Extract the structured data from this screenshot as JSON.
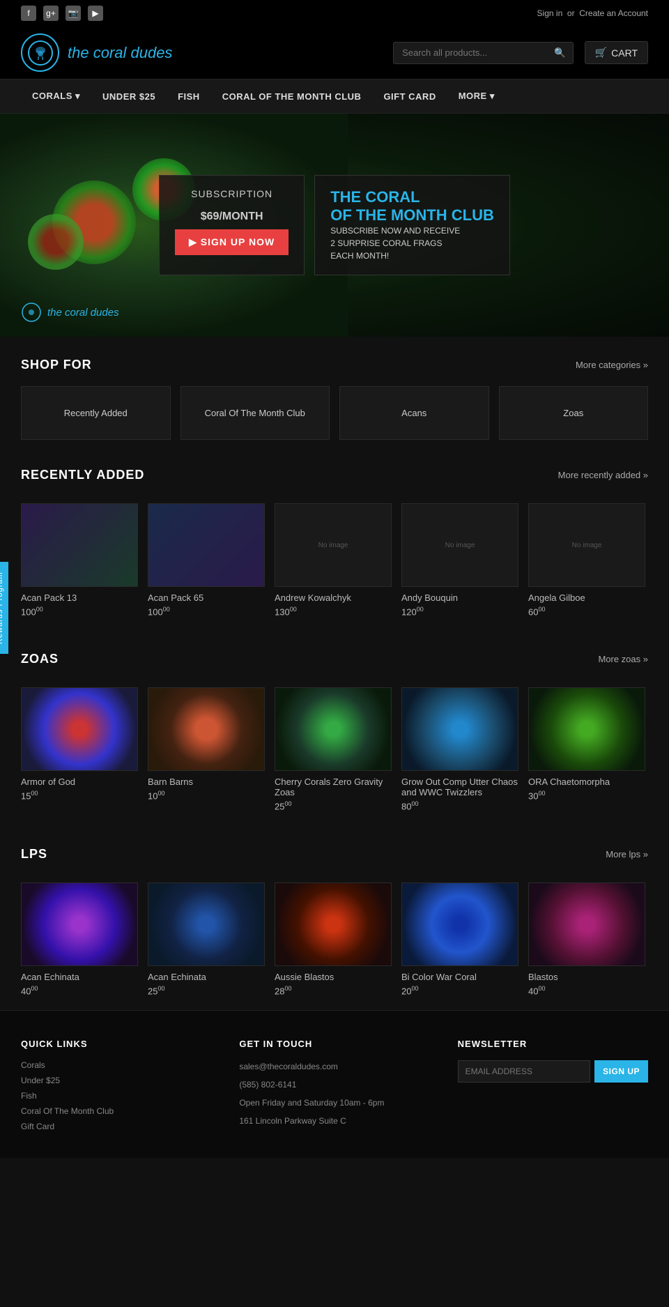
{
  "site": {
    "name": "the coral dudes",
    "tagline": "the coral dudes"
  },
  "top_bar": {
    "social_icons": [
      "f",
      "g+",
      "📷",
      "▶"
    ],
    "sign_in": "Sign in",
    "or": "or",
    "create_account": "Create an Account"
  },
  "header": {
    "search_placeholder": "Search all products...",
    "cart_label": "CART"
  },
  "nav": {
    "items": [
      {
        "label": "CORALS",
        "has_dropdown": true
      },
      {
        "label": "UNDER $25",
        "has_dropdown": false
      },
      {
        "label": "FISH",
        "has_dropdown": false
      },
      {
        "label": "CORAL OF THE MONTH CLUB",
        "has_dropdown": false
      },
      {
        "label": "GIFT CARD",
        "has_dropdown": false
      },
      {
        "label": "MORE",
        "has_dropdown": true
      }
    ]
  },
  "hero": {
    "subscription_label": "SUBSCRIPTION",
    "price": "$69",
    "per_month": "/MONTH",
    "signup_btn": "▶ SIGN UP NOW",
    "title_line1": "THE CORAL",
    "title_line2": "OF THE MONTH CLUB",
    "description": "SUBSCRIBE NOW AND RECEIVE\n2 SURPRISE CORAL FRAGS\nEACH MONTH!",
    "logo_text": "the coral dudes"
  },
  "shop_for": {
    "title": "SHOP FOR",
    "more_label": "More categories »",
    "categories": [
      {
        "label": "Recently Added"
      },
      {
        "label": "Coral Of The Month Club"
      },
      {
        "label": "Acans"
      },
      {
        "label": "Zoas"
      }
    ]
  },
  "recently_added": {
    "title": "RECENTLY ADDED",
    "more_label": "More recently added »",
    "products": [
      {
        "name": "Acan Pack 13",
        "price": "100",
        "cents": "00",
        "img_class": "img-acan-pack13"
      },
      {
        "name": "Acan Pack 65",
        "price": "100",
        "cents": "00",
        "img_class": "img-acan-pack65"
      },
      {
        "name": "Andrew Kowalchyk",
        "price": "130",
        "cents": "00",
        "img_class": "img-andrew",
        "no_image": true
      },
      {
        "name": "Andy Bouquin",
        "price": "120",
        "cents": "00",
        "img_class": "img-andy",
        "no_image": true
      },
      {
        "name": "Angela Gilboe",
        "price": "60",
        "cents": "00",
        "img_class": "img-angela",
        "no_image": true
      }
    ]
  },
  "zoas": {
    "title": "ZOAS",
    "more_label": "More zoas »",
    "products": [
      {
        "name": "Armor of God",
        "price": "15",
        "cents": "00",
        "img_class": "img-armor"
      },
      {
        "name": "Barn Barns",
        "price": "10",
        "cents": "00",
        "img_class": "img-barn"
      },
      {
        "name": "Cherry Corals Zero Gravity Zoas",
        "price": "25",
        "cents": "00",
        "img_class": "img-cherry"
      },
      {
        "name": "Grow Out Comp Utter Chaos and WWC Twizzlers",
        "price": "80",
        "cents": "00",
        "img_class": "img-grow"
      },
      {
        "name": "ORA Chaetomorpha",
        "price": "30",
        "cents": "00",
        "img_class": "img-ora"
      }
    ]
  },
  "lps": {
    "title": "LPS",
    "more_label": "More lps »",
    "products": [
      {
        "name": "Acan Echinata",
        "price": "40",
        "cents": "00",
        "img_class": "img-acan-enc1"
      },
      {
        "name": "Acan Echinata",
        "price": "25",
        "cents": "00",
        "img_class": "img-acan-enc2"
      },
      {
        "name": "Aussie Blastos",
        "price": "28",
        "cents": "00",
        "img_class": "img-aussie"
      },
      {
        "name": "Bi Color War Coral",
        "price": "20",
        "cents": "00",
        "img_class": "img-bicolor"
      },
      {
        "name": "Blastos",
        "price": "40",
        "cents": "00",
        "img_class": "img-blastos"
      }
    ]
  },
  "rewards": {
    "label": "Rewards Program"
  },
  "footer": {
    "quick_links": {
      "title": "QUICK LINKS",
      "links": [
        "Corals",
        "Under $25",
        "Fish",
        "Coral Of The Month Club",
        "Gift Card"
      ]
    },
    "get_in_touch": {
      "title": "GET IN TOUCH",
      "email": "sales@thecoraldudes.com",
      "phone": "(585) 802-6141",
      "hours": "Open Friday and Saturday 10am - 6pm",
      "address": "161 Lincoln Parkway Suite C"
    },
    "newsletter": {
      "title": "NEWSLETTER",
      "placeholder": "EMAIL ADDRESS",
      "signup_btn": "SIGN UP"
    }
  }
}
